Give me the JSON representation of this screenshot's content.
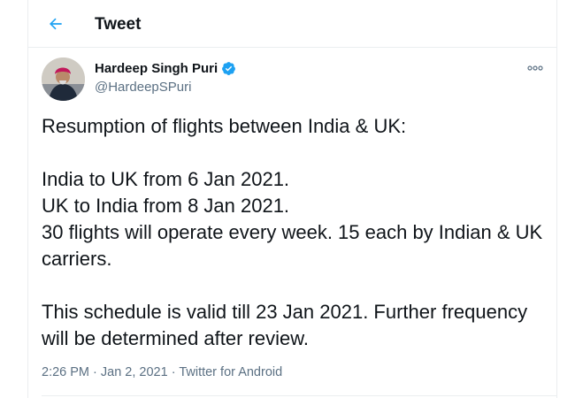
{
  "header": {
    "title": "Tweet",
    "back_icon": "arrow-left-icon"
  },
  "author": {
    "display_name": "Hardeep Singh Puri",
    "handle": "@HardeepSPuri",
    "verified_icon": "verified-badge-icon",
    "verified_color": "#1da1f2"
  },
  "tweet": {
    "text": "Resumption of flights between India & UK:\n\nIndia to UK from 6 Jan 2021.\nUK to India from 8 Jan 2021.\n30 flights will operate every week. 15 each by Indian & UK carriers.\n\nThis schedule is valid till 23 Jan 2021. Further frequency will be determined after review.",
    "time": "2:26 PM",
    "date": "Jan 2, 2021",
    "source": "Twitter for Android",
    "separator": " · "
  },
  "colors": {
    "accent": "#1da1f2",
    "secondary_text": "#5b7083"
  }
}
